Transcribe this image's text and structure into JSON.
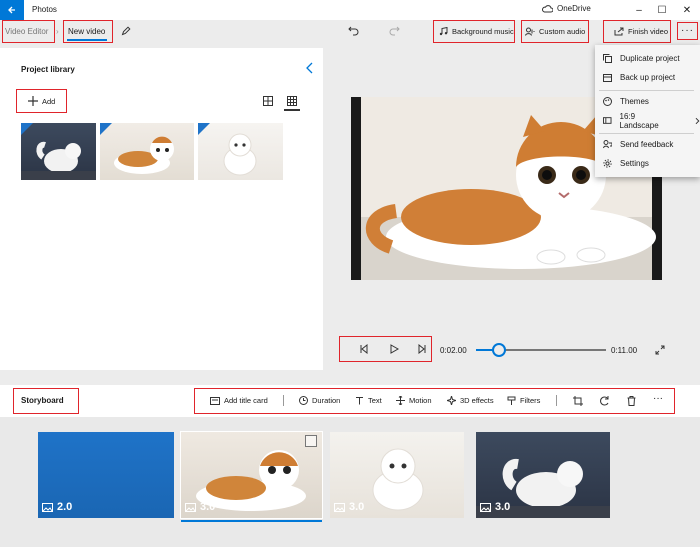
{
  "window": {
    "app_title": "Photos",
    "onedrive_label": "OneDrive",
    "controls": [
      "–",
      "☐",
      "✕"
    ]
  },
  "toolbar": {
    "breadcrumb_root": "Video Editor",
    "project_name": "New video",
    "background_music": "Background music",
    "custom_audio": "Custom audio",
    "finish_video": "Finish video",
    "more": "···"
  },
  "library": {
    "title": "Project library",
    "add_label": "Add"
  },
  "menu": {
    "items": [
      {
        "label": "Duplicate project",
        "icon": "duplicate-icon"
      },
      {
        "label": "Back up project",
        "icon": "backup-icon"
      },
      {
        "label": "Themes",
        "icon": "themes-icon"
      },
      {
        "label": "16:9 Landscape",
        "icon": "aspect-ratio-icon"
      },
      {
        "label": "Send feedback",
        "icon": "feedback-icon"
      },
      {
        "label": "Settings",
        "icon": "gear-icon"
      }
    ]
  },
  "playback": {
    "current_time": "0:02.00",
    "total_time": "0:11.00",
    "progress": 0.18
  },
  "storyboard": {
    "title": "Storyboard",
    "tools": {
      "add_title_card": "Add title card",
      "duration": "Duration",
      "text": "Text",
      "motion": "Motion",
      "effects_3d": "3D effects",
      "filters": "Filters"
    },
    "clips": [
      {
        "duration": "2.0",
        "kind": "title-card"
      },
      {
        "duration": "3.0",
        "kind": "image",
        "selected": true
      },
      {
        "duration": "3.0",
        "kind": "image"
      },
      {
        "duration": "3.0",
        "kind": "image"
      }
    ]
  },
  "colors": {
    "accent": "#0078d7",
    "highlight_box": "#e0242b",
    "title_card": "#1f73c8"
  }
}
